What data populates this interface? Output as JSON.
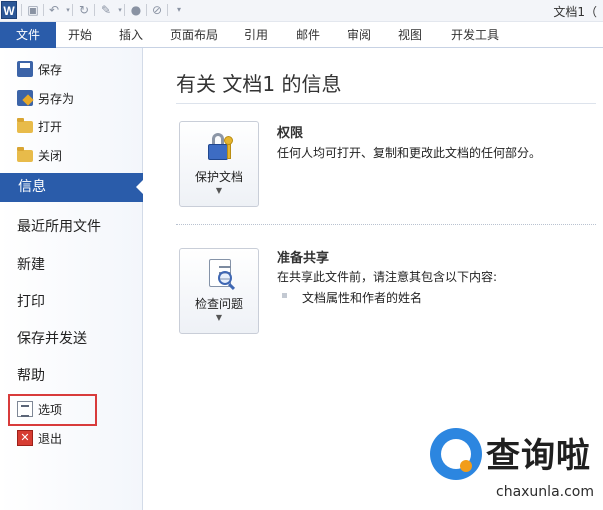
{
  "window": {
    "logo": "W",
    "title": "文档1（"
  },
  "quick_access": {
    "icons": [
      "save-icon",
      "undo-icon",
      "redo-icon",
      "format-painter-icon",
      "circle-icon",
      "pen-icon",
      "customize-dropdown-icon"
    ]
  },
  "ribbon": {
    "file_tab": "文件",
    "tabs": [
      "开始",
      "插入",
      "页面布局",
      "引用",
      "邮件",
      "审阅",
      "视图",
      "开发工具"
    ]
  },
  "backstage_menu": {
    "save": "保存",
    "save_as": "另存为",
    "open": "打开",
    "close": "关闭",
    "info": "信息",
    "recent": "最近所用文件",
    "new": "新建",
    "print": "打印",
    "save_send": "保存并发送",
    "help": "帮助",
    "options": "选项",
    "exit": "退出"
  },
  "info_page": {
    "title": "有关 文档1 的信息",
    "permissions": {
      "button_label": "保护文档",
      "heading": "权限",
      "description": "任何人均可打开、复制和更改此文档的任何部分。"
    },
    "prepare_share": {
      "button_label": "检查问题",
      "heading": "准备共享",
      "description": "在共享此文件前，请注意其包含以下内容:",
      "items": [
        "文档属性和作者的姓名"
      ]
    }
  },
  "watermark": {
    "brand": "查询啦",
    "url": "chaxunla.com"
  },
  "colors": {
    "accent": "#2a5caa",
    "highlight_border": "#d83b3b"
  }
}
